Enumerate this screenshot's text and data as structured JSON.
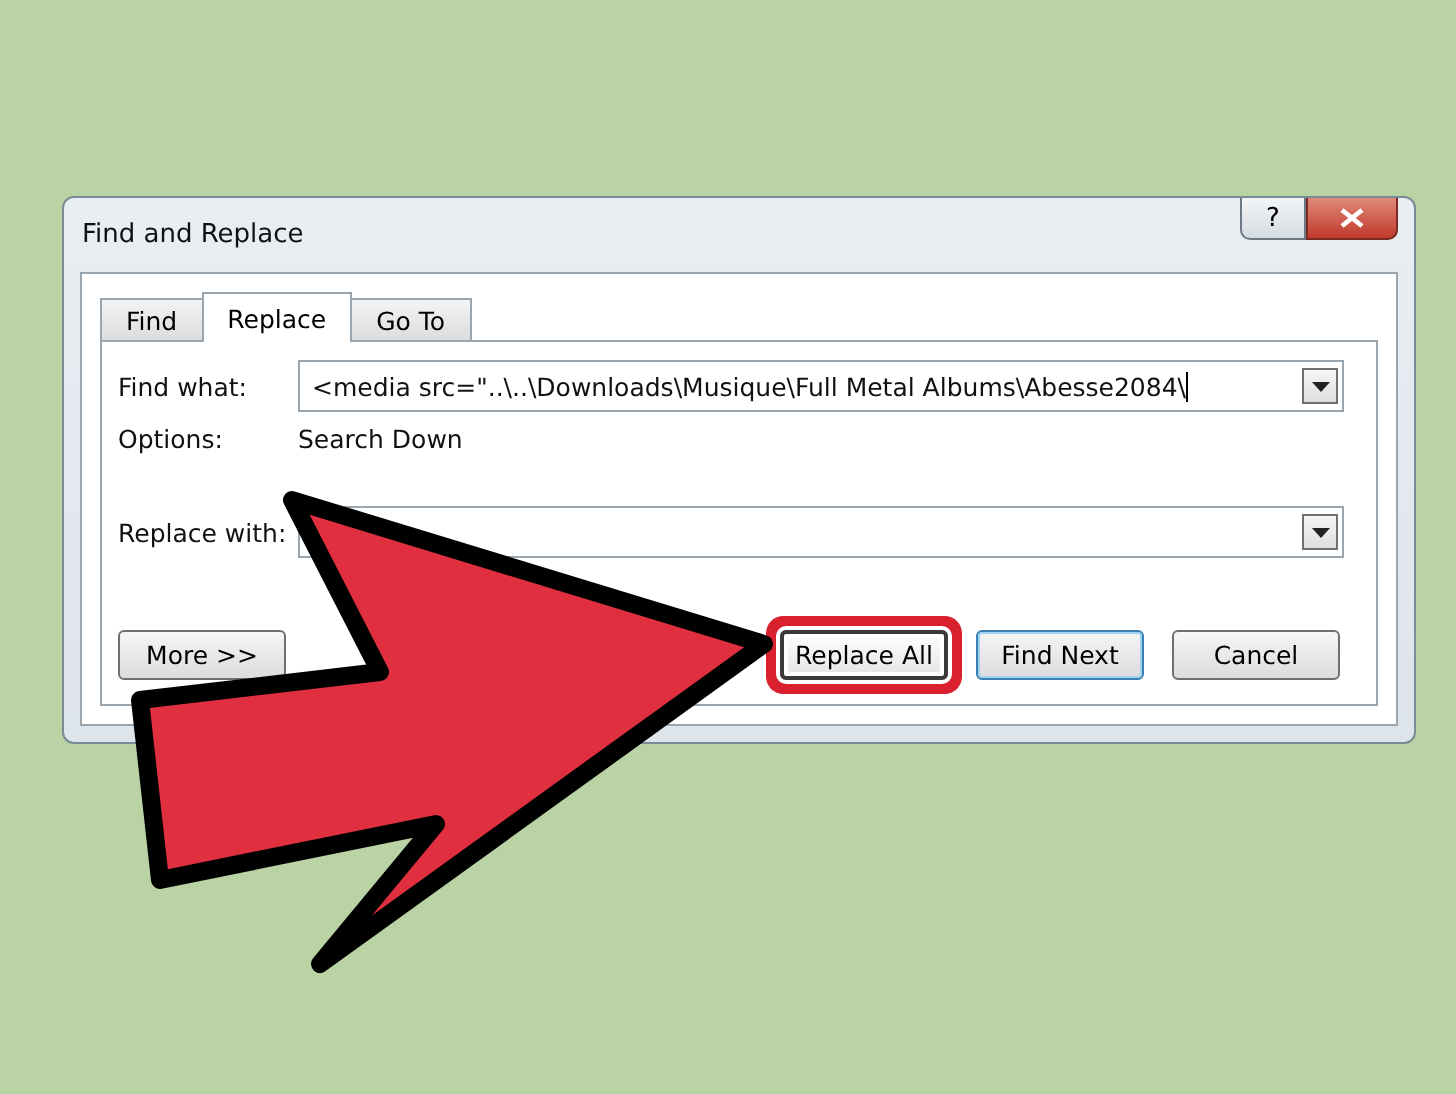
{
  "window": {
    "title": "Find and Replace",
    "help_label": "?"
  },
  "tabs": [
    {
      "label": "Find",
      "selected": false
    },
    {
      "label": "Replace",
      "selected": true
    },
    {
      "label": "Go To",
      "selected": false
    }
  ],
  "find_what": {
    "label": "Find what:",
    "value": "<media src=\"..\\..\\Downloads\\Musique\\Full Metal Albums\\Abesse2084\\"
  },
  "options": {
    "label": "Options:",
    "value": "Search Down"
  },
  "replace_with": {
    "label": "Replace with:"
  },
  "buttons": [
    {
      "label": "More >>",
      "highlighted": false
    },
    {
      "label": "Replace All",
      "highlighted": true
    },
    {
      "label": "Find Next",
      "highlighted": false
    },
    {
      "label": "Cancel",
      "highlighted": false
    }
  ]
}
